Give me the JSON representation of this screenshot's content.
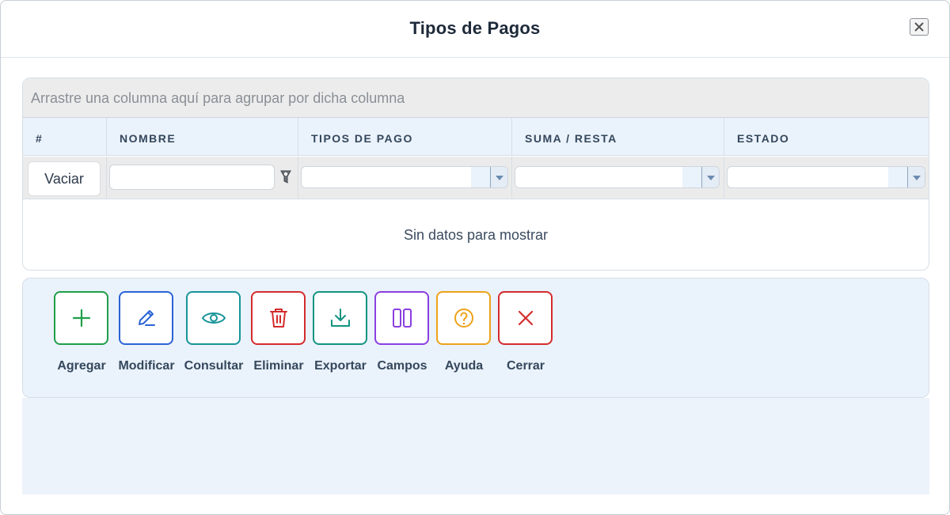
{
  "dialog": {
    "title": "Tipos de Pagos",
    "close_icon": "close-icon"
  },
  "grid": {
    "group_panel_text": "Arrastre una columna aquí para agrupar por dicha columna",
    "columns": [
      "#",
      "NOMBRE",
      "TIPOS DE PAGO",
      "SUMA / RESTA",
      "ESTADO"
    ],
    "filters": {
      "clear_label": "Vaciar",
      "nombre_value": "",
      "tipos_de_pago_value": "",
      "suma_resta_value": "",
      "estado_value": ""
    },
    "empty_message": "Sin datos para mostrar",
    "rows": []
  },
  "toolbar": {
    "buttons": [
      {
        "label": "Agregar",
        "icon": "plus-icon",
        "color": "#1e9e4a"
      },
      {
        "label": "Modificar",
        "icon": "pencil-icon",
        "color": "#2b63d6"
      },
      {
        "label": "Consultar",
        "icon": "eye-icon",
        "color": "#17949a"
      },
      {
        "label": "Eliminar",
        "icon": "trash-icon",
        "color": "#d42c2c"
      },
      {
        "label": "Exportar",
        "icon": "download-icon",
        "color": "#129481"
      },
      {
        "label": "Campos",
        "icon": "columns-icon",
        "color": "#8a3fe0"
      },
      {
        "label": "Ayuda",
        "icon": "help-icon",
        "color": "#eea21a"
      },
      {
        "label": "Cerrar",
        "icon": "close-icon",
        "color": "#d42c2c"
      }
    ]
  },
  "colors": {
    "header_bg": "#eaf2fb",
    "group_panel_bg": "#ececec",
    "toolbar_bg": "#eaf2fb"
  }
}
